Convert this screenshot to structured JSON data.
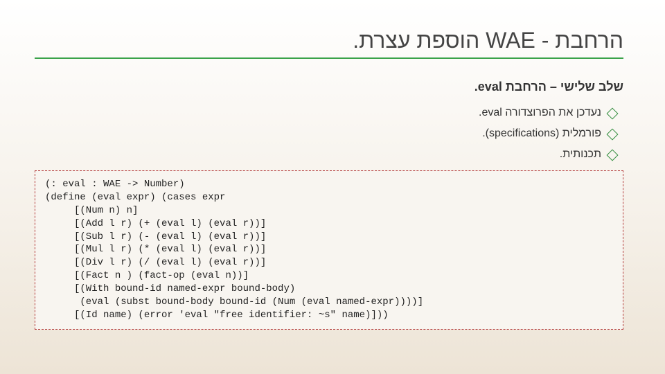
{
  "title": "הרחבת - WAE הוספת עצרת.",
  "heading": "שלב שלישי – הרחבת eval.",
  "bullets": [
    "נעדכן את הפרוצדורה eval.",
    "פורמלית (specifications).",
    "תכנותית."
  ],
  "code": "(: eval : WAE -> Number)\n(define (eval expr) (cases expr\n     [(Num n) n]\n     [(Add l r) (+ (eval l) (eval r))]\n     [(Sub l r) (- (eval l) (eval r))]\n     [(Mul l r) (* (eval l) (eval r))]\n     [(Div l r) (/ (eval l) (eval r))]\n     [(Fact n ) (fact-op (eval n))]\n     [(With bound-id named-expr bound-body)\n      (eval (subst bound-body bound-id (Num (eval named-expr))))]\n     [(Id name) (error 'eval \"free identifier: ~s\" name)]))"
}
